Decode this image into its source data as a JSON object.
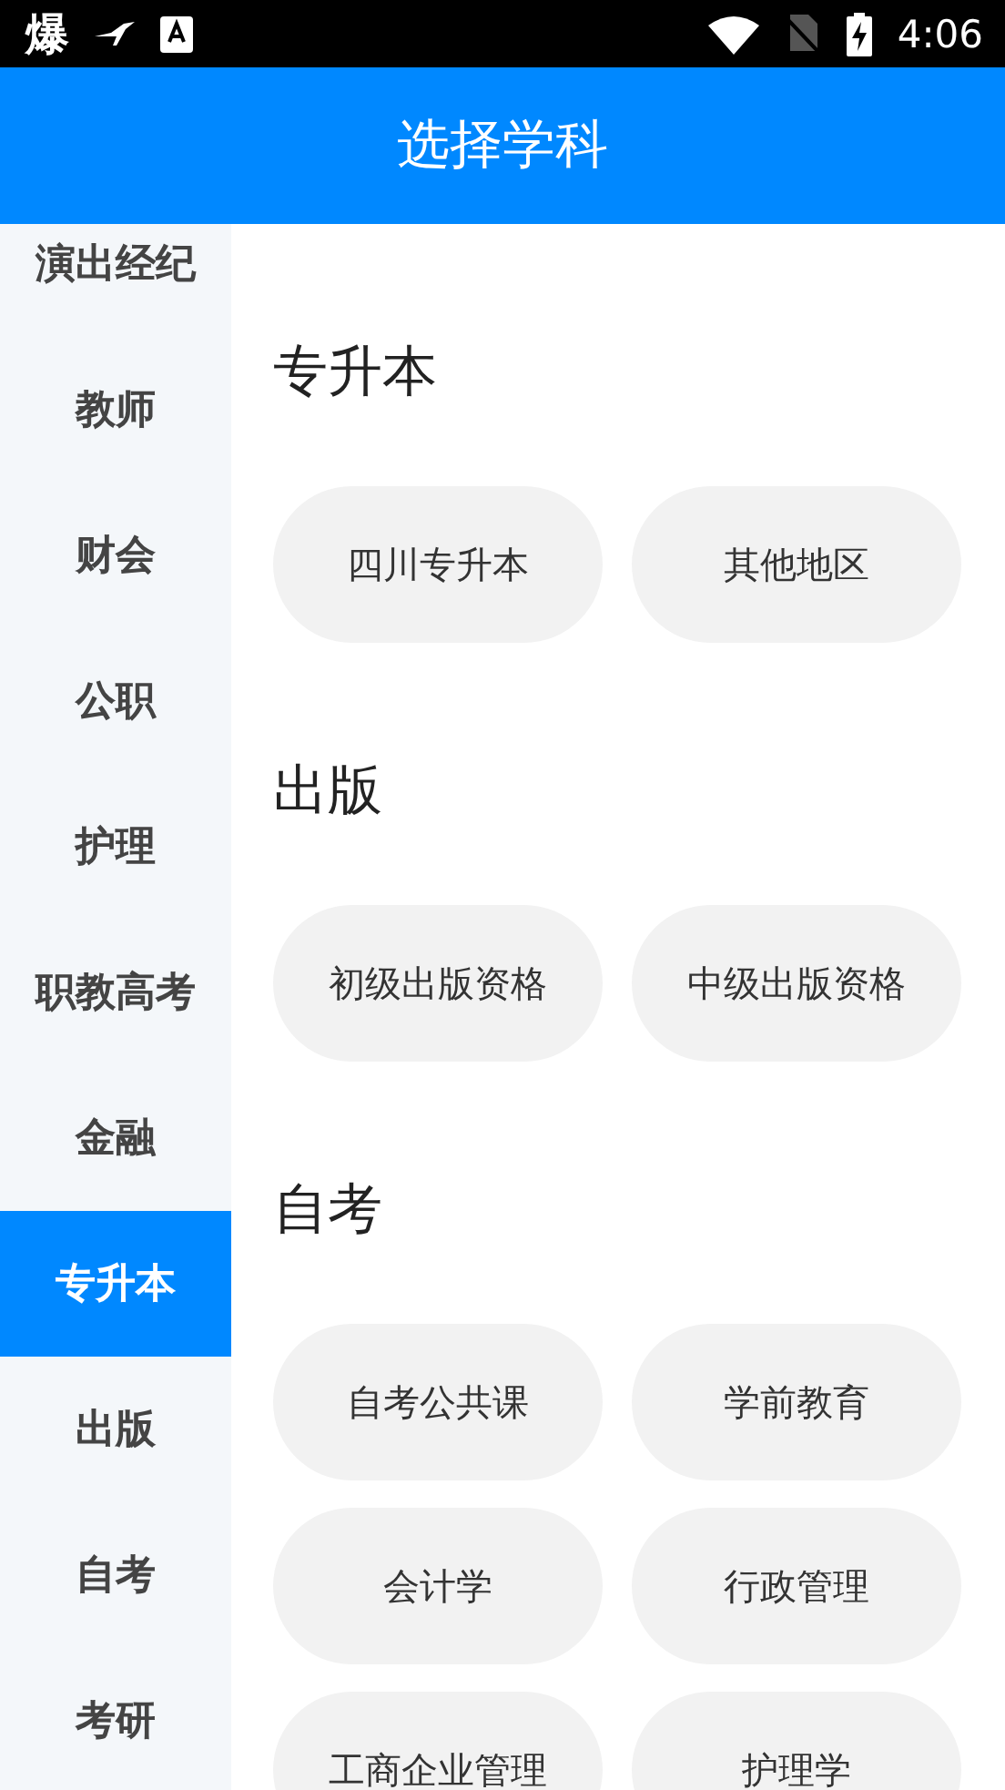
{
  "status_bar": {
    "app_glyph": "爆",
    "time": "4:06"
  },
  "header": {
    "title": "选择学科"
  },
  "sidebar": {
    "items": [
      {
        "label": "演出经纪",
        "selected": false
      },
      {
        "label": "教师",
        "selected": false
      },
      {
        "label": "财会",
        "selected": false
      },
      {
        "label": "公职",
        "selected": false
      },
      {
        "label": "护理",
        "selected": false
      },
      {
        "label": "职教高考",
        "selected": false
      },
      {
        "label": "金融",
        "selected": false
      },
      {
        "label": "专升本",
        "selected": true
      },
      {
        "label": "出版",
        "selected": false
      },
      {
        "label": "自考",
        "selected": false
      },
      {
        "label": "考研",
        "selected": false
      }
    ]
  },
  "sections": [
    {
      "title": "专升本",
      "subjects": [
        "四川专升本",
        "其他地区"
      ]
    },
    {
      "title": "出版",
      "subjects": [
        "初级出版资格",
        "中级出版资格"
      ]
    },
    {
      "title": "自考",
      "subjects": [
        "自考公共课",
        "学前教育",
        "会计学",
        "行政管理",
        "工商企业管理",
        "护理学"
      ]
    }
  ]
}
